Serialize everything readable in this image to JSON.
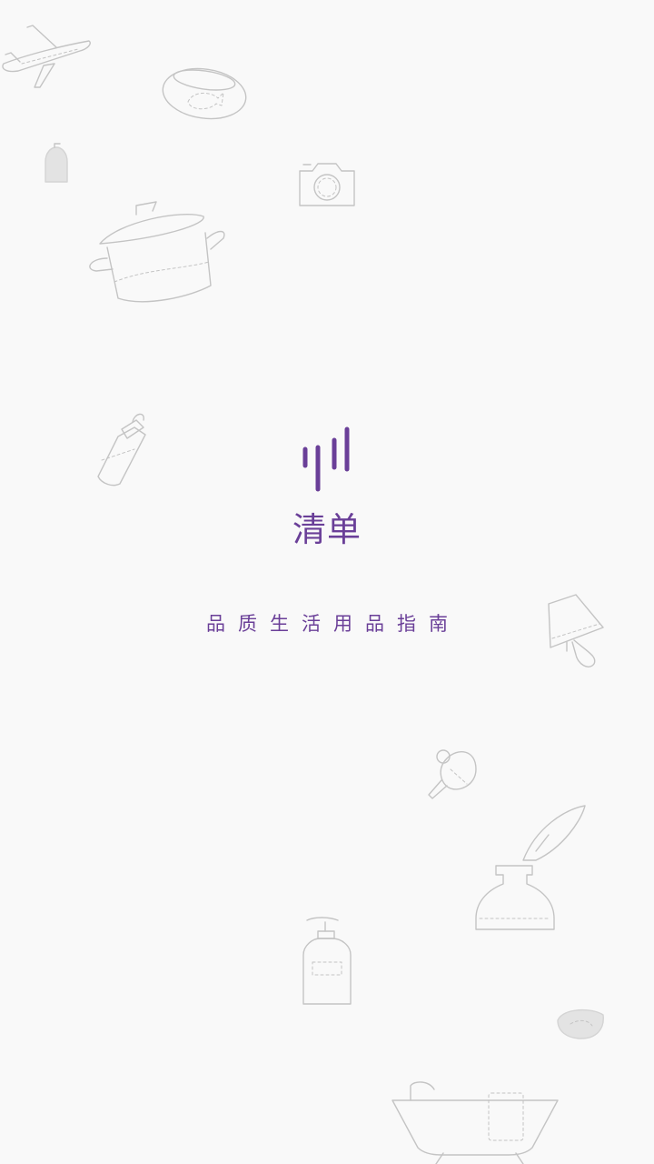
{
  "splash": {
    "app_name": "清单",
    "tagline": "品质生活用品指南",
    "brand_color": "#6a3f98",
    "background_color": "#f9f9f9",
    "logo_icon": "sound-bars-logo"
  },
  "doodles": [
    "airplane-icon",
    "pet-bowl-icon",
    "soap-dispenser-icon",
    "camera-icon",
    "cooking-pot-icon",
    "baby-bottle-icon",
    "lamp-shade-icon",
    "ping-pong-paddle-icon",
    "ink-bottle-feather-icon",
    "lotion-bottle-icon",
    "small-bowl-icon",
    "bathtub-icon"
  ]
}
